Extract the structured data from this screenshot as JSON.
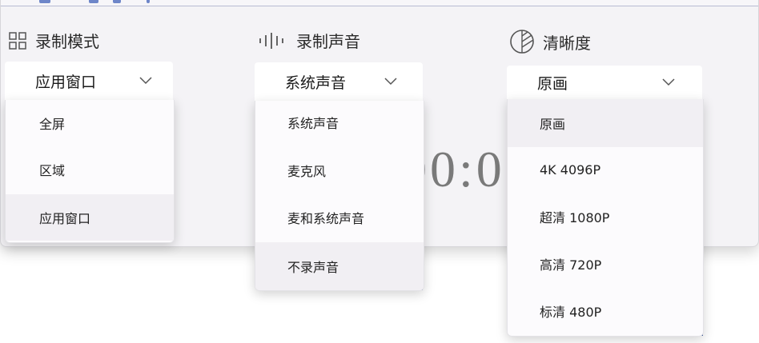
{
  "timer_text": "00:0",
  "sections": {
    "mode": {
      "title": "录制模式",
      "icon": "grid-icon",
      "selected": "应用窗口",
      "options": [
        {
          "label": "全屏",
          "selected": false
        },
        {
          "label": "区域",
          "selected": false
        },
        {
          "label": "应用窗口",
          "selected": true
        }
      ]
    },
    "audio": {
      "title": "录制声音",
      "icon": "sound-wave-icon",
      "selected": "系统声音",
      "options": [
        {
          "label": "系统声音",
          "selected": false
        },
        {
          "label": "麦克风",
          "selected": false
        },
        {
          "label": "麦和系统声音",
          "selected": false
        },
        {
          "label": "不录声音",
          "selected": true
        }
      ]
    },
    "quality": {
      "title": "清晰度",
      "icon": "quality-circle-icon",
      "selected": "原画",
      "options": [
        {
          "label": "原画",
          "selected": true
        },
        {
          "label": "4K 4096P",
          "selected": false
        },
        {
          "label": "超清 1080P",
          "selected": false
        },
        {
          "label": "高清 720P",
          "selected": false
        },
        {
          "label": "标清 480P",
          "selected": false
        }
      ]
    }
  },
  "colors": {
    "accent": "#1a3f8e",
    "hover": "#f1eff3",
    "window_bg": "#f4f3f6"
  }
}
